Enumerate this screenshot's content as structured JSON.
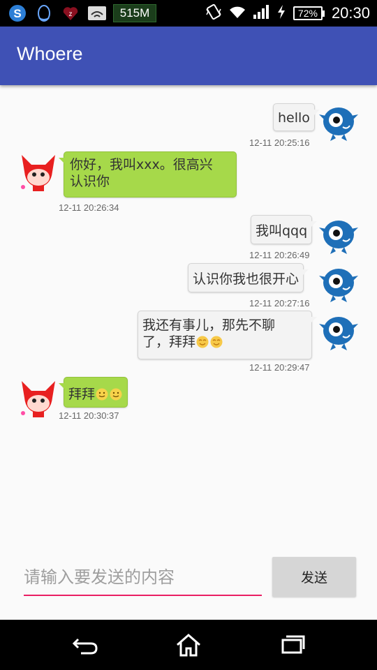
{
  "status_bar": {
    "memory": "515M",
    "battery": "72%",
    "time": "20:30",
    "icons": [
      "sync-s-icon",
      "qq-penguin-icon",
      "heart-z-icon",
      "image-wifi-icon",
      "vibrate-icon",
      "wifi-icon",
      "signal-icon",
      "charging-icon",
      "battery-icon"
    ]
  },
  "app_bar": {
    "title": "Whoere"
  },
  "messages": [
    {
      "side": "right",
      "text": "hello",
      "time": "12-11 20:25:16"
    },
    {
      "side": "left",
      "line1": "你好，我叫xxx。很高兴",
      "line2": "认识你",
      "time": "12-11 20:26:34"
    },
    {
      "side": "right",
      "text": "我叫qqq",
      "time": "12-11 20:26:49"
    },
    {
      "side": "right",
      "text": "认识你我也很开心",
      "time": "12-11 20:27:16"
    },
    {
      "side": "right",
      "line1": "我还有事儿，那先不聊",
      "line2": "了，拜拜",
      "time": "12-11 20:29:47",
      "emoji": [
        "grin-emoji",
        "grin-emoji"
      ]
    },
    {
      "side": "left",
      "text": "拜拜",
      "time": "12-11 20:30:37",
      "emoji": [
        "smile-emoji",
        "smile-emoji"
      ]
    }
  ],
  "composer": {
    "placeholder": "请输入要发送的内容",
    "send_label": "发送"
  },
  "colors": {
    "app_bar": "#3f51b5",
    "right_bubble": "#f3f3f3",
    "left_bubble": "#a6d94a",
    "input_underline": "#e91e63"
  }
}
